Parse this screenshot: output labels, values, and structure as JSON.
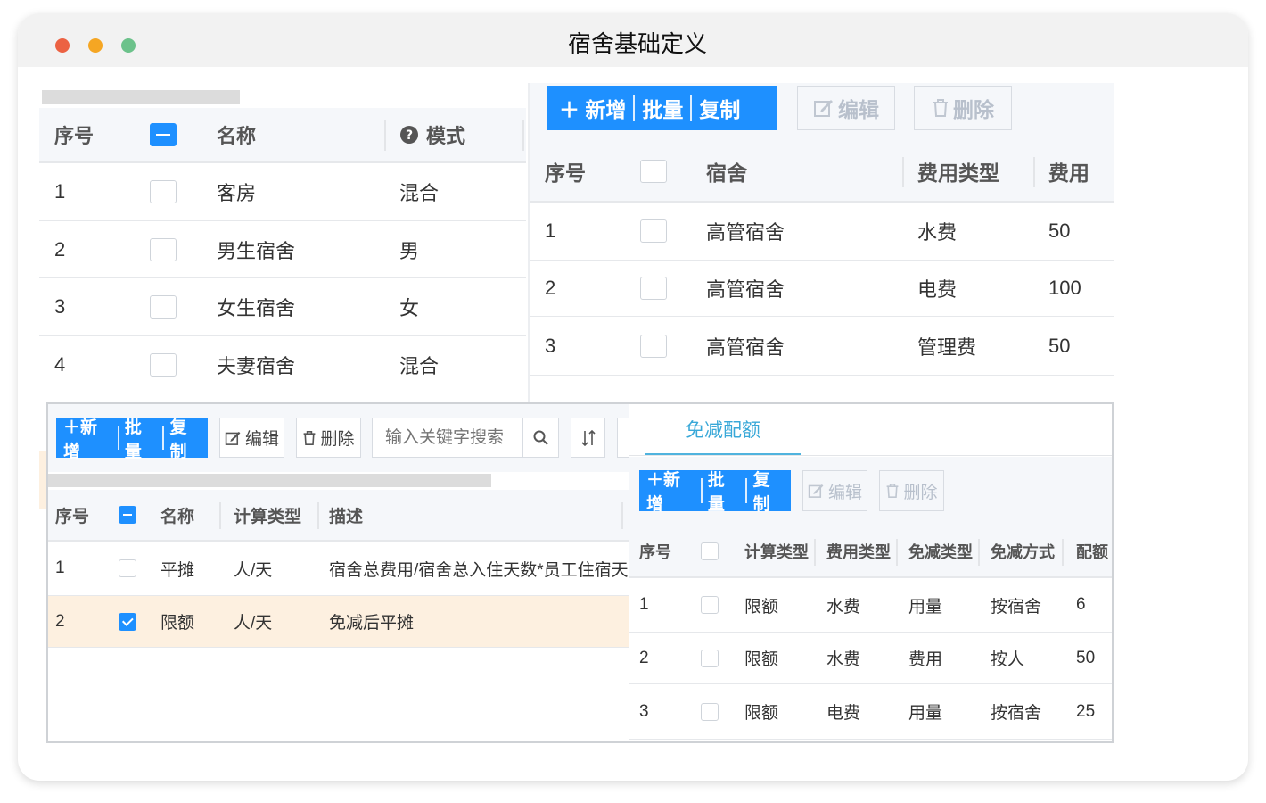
{
  "window": {
    "title": "宿舍基础定义"
  },
  "panelA": {
    "headers": {
      "seq": "序号",
      "name": "名称",
      "mode": "模式"
    },
    "rows": [
      {
        "seq": "1",
        "name": "客房",
        "mode": "混合"
      },
      {
        "seq": "2",
        "name": "男生宿舍",
        "mode": "男"
      },
      {
        "seq": "3",
        "name": "女生宿舍",
        "mode": "女"
      },
      {
        "seq": "4",
        "name": "夫妻宿舍",
        "mode": "混合"
      }
    ]
  },
  "panelB": {
    "toolbar": {
      "add": "＋ 新增",
      "batch": "批量",
      "copy": "复制",
      "edit": "编辑",
      "delete": "删除"
    },
    "headers": {
      "seq": "序号",
      "dorm": "宿舍",
      "fee_type": "费用类型",
      "fee": "费用"
    },
    "rows": [
      {
        "seq": "1",
        "dorm": "高管宿舍",
        "fee_type": "水费",
        "fee": "50"
      },
      {
        "seq": "2",
        "dorm": "高管宿舍",
        "fee_type": "电费",
        "fee": "100"
      },
      {
        "seq": "3",
        "dorm": "高管宿舍",
        "fee_type": "管理费",
        "fee": "50"
      }
    ]
  },
  "panelC": {
    "toolbar": {
      "add": "＋新增",
      "batch": "批量",
      "copy": "复制",
      "edit": "编辑",
      "delete": "删除",
      "search_placeholder": "输入关键字搜索"
    },
    "headers": {
      "seq": "序号",
      "name": "名称",
      "calc_type": "计算类型",
      "desc": "描述"
    },
    "rows": [
      {
        "seq": "1",
        "name": "平摊",
        "calc_type": "人/天",
        "desc": "宿舍总费用/宿舍总入住天数*员工住宿天数",
        "checked": false
      },
      {
        "seq": "2",
        "name": "限额",
        "calc_type": "人/天",
        "desc": "免减后平摊",
        "checked": true
      }
    ]
  },
  "panelD": {
    "tab": "免减配额",
    "toolbar": {
      "add": "＋新增",
      "batch": "批量",
      "copy": "复制",
      "edit": "编辑",
      "delete": "删除"
    },
    "headers": {
      "seq": "序号",
      "calc_type": "计算类型",
      "fee_type": "费用类型",
      "reduce_type": "免减类型",
      "reduce_mode": "免减方式",
      "quota": "配额"
    },
    "rows": [
      {
        "seq": "1",
        "calc_type": "限额",
        "fee_type": "水费",
        "reduce_type": "用量",
        "reduce_mode": "按宿舍",
        "quota": "6"
      },
      {
        "seq": "2",
        "calc_type": "限额",
        "fee_type": "水费",
        "reduce_type": "费用",
        "reduce_mode": "按人",
        "quota": "50"
      },
      {
        "seq": "3",
        "calc_type": "限额",
        "fee_type": "电费",
        "reduce_type": "用量",
        "reduce_mode": "按宿舍",
        "quota": "25"
      }
    ]
  }
}
